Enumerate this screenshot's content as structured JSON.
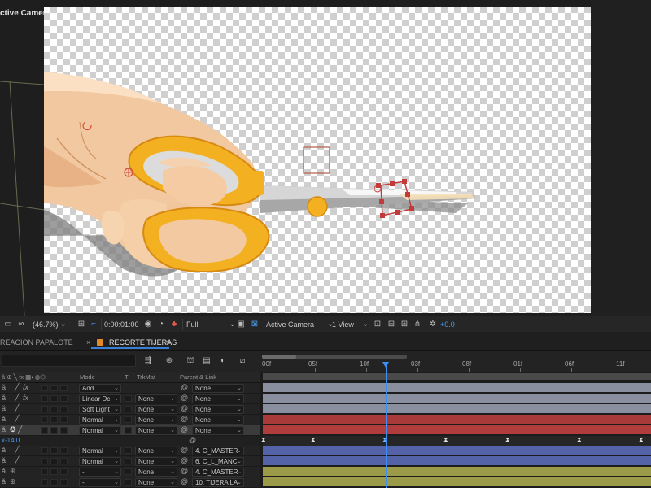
{
  "viewer": {
    "camera_label": "ctive Camera"
  },
  "viewer_toolbar": {
    "zoom": "(46.7%)",
    "timecode": "0:00:01:00",
    "resolution": "Full",
    "camera": "Active Camera",
    "views": "1 View",
    "exposure": "+0.0"
  },
  "tabs": [
    {
      "label": "REACION PAPALOTE"
    },
    {
      "label": "RECORTE TIJERAS"
    }
  ],
  "layers_header": {
    "mode": "Mode",
    "t": "T",
    "trkmat": "TrkMat",
    "parent": "Parent & Link"
  },
  "layers": [
    {
      "mode": "Add",
      "trkmat": "",
      "parent": "None",
      "fx": true
    },
    {
      "mode": "Linear Dc",
      "trkmat": "None",
      "parent": "None",
      "fx": true
    },
    {
      "mode": "Soft Light",
      "trkmat": "None",
      "parent": "None",
      "fx": false
    },
    {
      "mode": "Normal",
      "trkmat": "None",
      "parent": "None",
      "fx": false
    },
    {
      "mode": "Normal",
      "trkmat": "None",
      "parent": "None",
      "fx": false,
      "selected": true
    },
    {
      "mode": "Normal",
      "trkmat": "None",
      "parent": "4. C_MASTER",
      "fx": false
    },
    {
      "mode": "Normal",
      "trkmat": "None",
      "parent": "6. C_L_MANC",
      "fx": false
    },
    {
      "mode": "-",
      "trkmat": "None",
      "parent": "4. C_MASTER",
      "fx": false
    },
    {
      "mode": "-",
      "trkmat": "None",
      "parent": "10. TIJERA LA",
      "fx": false
    }
  ],
  "property_row": {
    "value": "x-14.0"
  },
  "ruler": {
    "labels": [
      "00f",
      "05f",
      "10f",
      "03f",
      "08f",
      "01f",
      "06f",
      "11f"
    ]
  },
  "colors": {
    "track_gray": "#8a8fa0",
    "track_red": "#a83a3a",
    "track_blue": "#5463a8",
    "track_olive": "#9a9a48",
    "playhead": "#3d8ef2"
  }
}
